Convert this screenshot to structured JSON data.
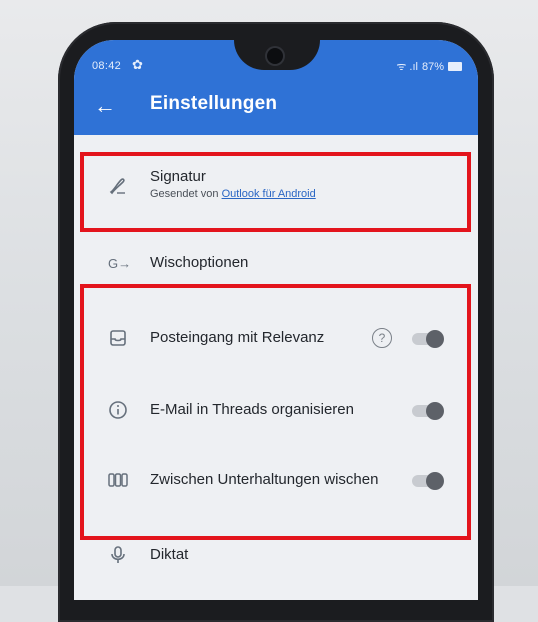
{
  "status_bar": {
    "time": "08:42",
    "signal": "ᯤ .ıl",
    "battery": "87%"
  },
  "app_bar": {
    "title": "Einstellungen",
    "back_icon": "arrow-left-icon",
    "color": "#2f72d6"
  },
  "settings": {
    "signature": {
      "label": "Signatur",
      "sub_prefix": "Gesendet von ",
      "sub_link": "Outlook für Android",
      "icon": "pen-icon"
    },
    "swipe": {
      "label": "Wischoptionen",
      "icon": "swipe-arrow-icon"
    },
    "focused_inbox": {
      "label": "Posteingang mit Relevanz",
      "icon": "inbox-icon",
      "help_icon": "?",
      "toggle_on": false
    },
    "threads": {
      "label": "E-Mail in Threads organisieren",
      "icon": "info-icon",
      "toggle_on": false
    },
    "swipe_conversations": {
      "label": "Zwischen Unterhaltungen wischen",
      "icon": "carousel-icon",
      "toggle_on": false
    },
    "dictation": {
      "label": "Diktat",
      "icon": "microphone-icon"
    }
  },
  "highlight_color": "#e3141c"
}
